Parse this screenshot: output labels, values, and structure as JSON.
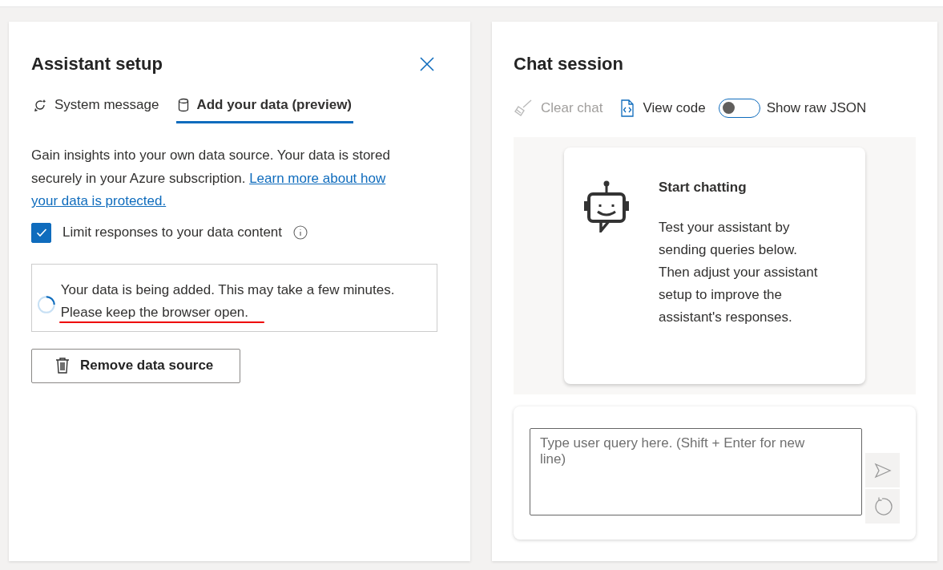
{
  "setup_panel": {
    "title": "Assistant setup",
    "tabs": [
      {
        "label": "System message",
        "selected": false,
        "kind": "message"
      },
      {
        "label": "Add your data (preview)",
        "selected": true,
        "kind": "data"
      }
    ],
    "description": "Gain insights into your own data source. Your data is stored securely in your Azure subscription.",
    "description_link": [
      "Learn more about how",
      "your data is protected."
    ],
    "limit_checkbox": {
      "label": "Limit responses to your data content",
      "checked": true
    },
    "progress_message": "Your data is being added. This may take a few minutes. Please keep the browser open.",
    "remove_button": "Remove data source"
  },
  "chat_panel": {
    "title": "Chat session",
    "toolbar": [
      {
        "kind": "clear",
        "label": "Clear chat",
        "disabled": true
      },
      {
        "kind": "code",
        "label": "View code",
        "disabled": false
      },
      {
        "kind": "toggle",
        "label": "Show raw JSON",
        "on": false
      }
    ],
    "welcome_card": {
      "title": "Start chatting",
      "body": "Test your assistant by sending queries below. Then adjust your assistant setup to improve the assistant's responses."
    },
    "query_field": {
      "placeholder": "Type user query here. (Shift + Enter for new line)"
    },
    "send_button": {
      "disabled": true
    }
  }
}
